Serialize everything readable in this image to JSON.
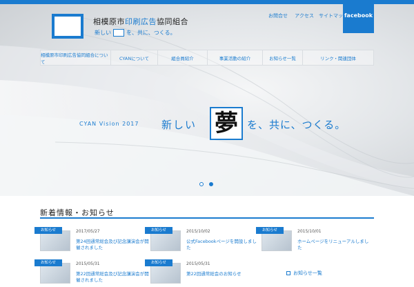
{
  "header": {
    "org_name_pre": "相模原市",
    "org_name_hl": "印刷広告",
    "org_name_post": "協同組合",
    "tagline_pre": "新しい",
    "tagline_post": "を、共に、つくる。",
    "top_links": [
      "お問合せ",
      "アクセス",
      "サイトマップ"
    ],
    "facebook_label": "facebook"
  },
  "nav": {
    "items": [
      "相模原市印刷広告協同組合について",
      "CYANについて",
      "組合員紹介",
      "事業活動の紹介",
      "お知らせ一覧",
      "リンク・関連団体"
    ]
  },
  "hero": {
    "vision_label": "CYAN Vision 2017",
    "catch_pre": "新しい",
    "catch_kanji": "夢",
    "catch_post": "を、共に、つくる。",
    "slide_count": 2,
    "active_slide": 2
  },
  "news": {
    "section_title": "新着情報・お知らせ",
    "items": [
      {
        "tag": "お知らせ",
        "date": "2017/05/27",
        "text": "第24回通常総会及び記念講演会が開催されました"
      },
      {
        "tag": "お知らせ",
        "date": "2015/10/02",
        "text": "公式Facebookページを開設しました"
      },
      {
        "tag": "お知らせ",
        "date": "2015/10/01",
        "text": "ホームページをリニューアルしました"
      },
      {
        "tag": "お知らせ",
        "date": "2015/05/31",
        "text": "第22回通常総会及び記念講演会が開催されました"
      },
      {
        "tag": "お知らせ",
        "date": "2015/05/31",
        "text": "第22回通常総会のお知らせ"
      }
    ],
    "side_link": "お知らせ一覧"
  },
  "colors": {
    "accent": "#1a7bcf"
  }
}
